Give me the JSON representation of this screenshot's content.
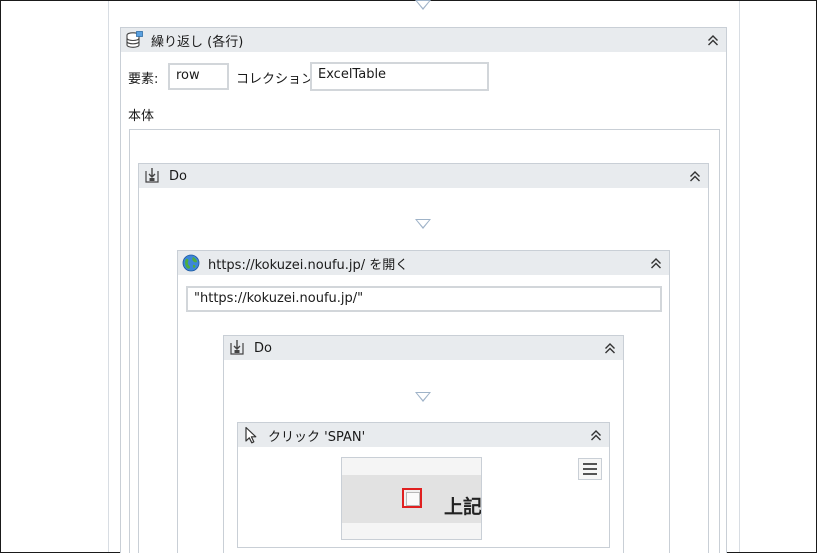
{
  "foreach": {
    "title": "繰り返し (各行)",
    "icon": "database-icon",
    "element_label": "要素:",
    "element_value": "row",
    "collection_label": "コレクション:",
    "collection_value": "ExcelTable",
    "body_label": "本体"
  },
  "do_outer": {
    "title": "Do",
    "icon": "sequence-icon"
  },
  "open_browser": {
    "title": "https://kokuzei.noufu.jp/ を開く",
    "icon": "globe-icon",
    "url_value": "\"https://kokuzei.noufu.jp/\""
  },
  "do_inner": {
    "title": "Do",
    "icon": "sequence-icon"
  },
  "click": {
    "title": "クリック 'SPAN'",
    "icon": "cursor-icon",
    "menu_icon": "hamburger-menu-icon",
    "target_text": "上記"
  },
  "colors": {
    "header_bg": "#e8ebee",
    "border": "#c9cfd6",
    "drop_arrow": "#9fb3c8",
    "target_highlight": "#e02020"
  }
}
